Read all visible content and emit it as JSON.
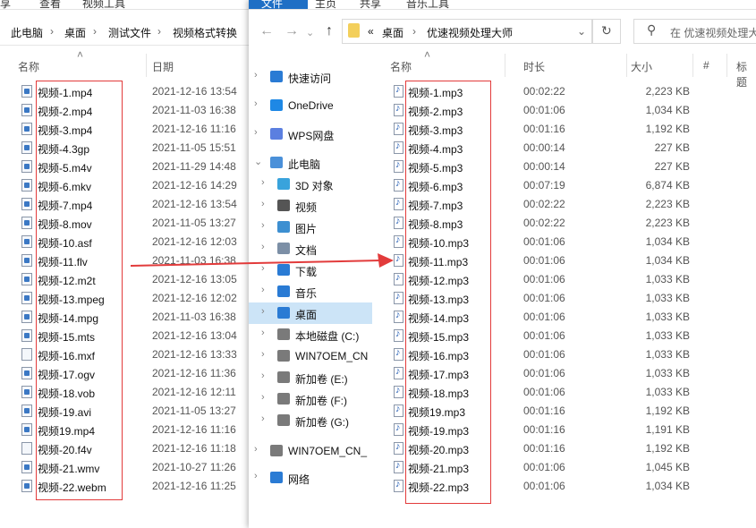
{
  "back_window": {
    "ribbon_tabs": [
      "享",
      "查看",
      "视频工具"
    ],
    "breadcrumb": [
      "此电脑",
      "桌面",
      "测试文件",
      "视频格式转换"
    ],
    "columns": {
      "name": "名称",
      "date": "日期"
    },
    "files": [
      {
        "name": "视频-1.mp4",
        "date": "2021-12-16 13:54",
        "icon": "video-file-icon"
      },
      {
        "name": "视频-2.mp4",
        "date": "2021-11-03 16:38",
        "icon": "video-file-icon"
      },
      {
        "name": "视频-3.mp4",
        "date": "2021-12-16 11:16",
        "icon": "video-file-icon"
      },
      {
        "name": "视频-4.3gp",
        "date": "2021-11-05 15:51",
        "icon": "video-file-icon"
      },
      {
        "name": "视频-5.m4v",
        "date": "2021-11-29 14:48",
        "icon": "video-file-icon"
      },
      {
        "name": "视频-6.mkv",
        "date": "2021-12-16 14:29",
        "icon": "video-file-icon"
      },
      {
        "name": "视频-7.mp4",
        "date": "2021-12-16 13:54",
        "icon": "video-file-icon"
      },
      {
        "name": "视频-8.mov",
        "date": "2021-11-05 13:27",
        "icon": "video-file-icon"
      },
      {
        "name": "视频-10.asf",
        "date": "2021-12-16 12:03",
        "icon": "video-file-icon"
      },
      {
        "name": "视频-11.flv",
        "date": "2021-11-03 16:38",
        "icon": "video-file-icon"
      },
      {
        "name": "视频-12.m2t",
        "date": "2021-12-16 13:05",
        "icon": "video-file-icon"
      },
      {
        "name": "视频-13.mpeg",
        "date": "2021-12-16 12:02",
        "icon": "video-file-icon"
      },
      {
        "name": "视频-14.mpg",
        "date": "2021-11-03 16:38",
        "icon": "video-file-icon"
      },
      {
        "name": "视频-15.mts",
        "date": "2021-12-16 13:04",
        "icon": "video-file-icon"
      },
      {
        "name": "视频-16.mxf",
        "date": "2021-12-16 13:33",
        "icon": "blank-file-icon"
      },
      {
        "name": "视频-17.ogv",
        "date": "2021-12-16 11:36",
        "icon": "video-file-icon"
      },
      {
        "name": "视频-18.vob",
        "date": "2021-12-16 12:11",
        "icon": "video-file-icon"
      },
      {
        "name": "视频-19.avi",
        "date": "2021-11-05 13:27",
        "icon": "video-file-icon"
      },
      {
        "name": "视频19.mp4",
        "date": "2021-12-16 11:16",
        "icon": "video-file-icon"
      },
      {
        "name": "视频-20.f4v",
        "date": "2021-12-16 11:18",
        "icon": "blank-file-icon"
      },
      {
        "name": "视频-21.wmv",
        "date": "2021-10-27 11:26",
        "icon": "video-file-icon"
      },
      {
        "name": "视频-22.webm",
        "date": "2021-12-16 11:25",
        "icon": "video-file-icon"
      }
    ]
  },
  "front_window": {
    "ribbon_tabs": [
      "文件",
      "主页",
      "共享",
      "音乐工具"
    ],
    "address": {
      "prefix": "«",
      "parts": [
        "桌面",
        "优速视频处理大师"
      ]
    },
    "search_placeholder": "在 优速视频处理大",
    "nav": [
      {
        "label": "快速访问",
        "icon": "star-icon",
        "color": "#2a7bd4"
      },
      {
        "label": "OneDrive",
        "icon": "cloud-icon",
        "color": "#1e88e5"
      },
      {
        "label": "WPS网盘",
        "icon": "cloud-icon",
        "color": "#5b7fe0"
      },
      {
        "label": "此电脑",
        "icon": "computer-icon",
        "color": "#4a90d9"
      },
      {
        "label": "3D 对象",
        "icon": "cube-icon",
        "color": "#39a3dc"
      },
      {
        "label": "视频",
        "icon": "film-icon",
        "color": "#555555"
      },
      {
        "label": "图片",
        "icon": "picture-icon",
        "color": "#3d8fd1"
      },
      {
        "label": "文档",
        "icon": "document-icon",
        "color": "#7c8fa6"
      },
      {
        "label": "下载",
        "icon": "download-icon",
        "color": "#2a7bd4"
      },
      {
        "label": "音乐",
        "icon": "music-icon",
        "color": "#2a7bd4"
      },
      {
        "label": "桌面",
        "icon": "desktop-icon",
        "color": "#2a7bd4"
      },
      {
        "label": "本地磁盘 (C:)",
        "icon": "drive-icon",
        "color": "#7a7a7a"
      },
      {
        "label": "WIN7OEM_CN",
        "icon": "drive-icon",
        "color": "#7a7a7a"
      },
      {
        "label": "新加卷 (E:)",
        "icon": "drive-icon",
        "color": "#7a7a7a"
      },
      {
        "label": "新加卷 (F:)",
        "icon": "drive-icon",
        "color": "#7a7a7a"
      },
      {
        "label": "新加卷 (G:)",
        "icon": "drive-icon",
        "color": "#7a7a7a"
      },
      {
        "label": "WIN7OEM_CN_",
        "icon": "drive-icon",
        "color": "#7a7a7a"
      },
      {
        "label": "网络",
        "icon": "network-icon",
        "color": "#2a7bd4"
      }
    ],
    "columns": {
      "name": "名称",
      "length": "时长",
      "size": "大小",
      "number": "#",
      "title": "标题"
    },
    "files": [
      {
        "name": "视频-1.mp3",
        "length": "00:02:22",
        "size": "2,223 KB"
      },
      {
        "name": "视频-2.mp3",
        "length": "00:01:06",
        "size": "1,034 KB"
      },
      {
        "name": "视频-3.mp3",
        "length": "00:01:16",
        "size": "1,192 KB"
      },
      {
        "name": "视频-4.mp3",
        "length": "00:00:14",
        "size": "227 KB"
      },
      {
        "name": "视频-5.mp3",
        "length": "00:00:14",
        "size": "227 KB"
      },
      {
        "name": "视频-6.mp3",
        "length": "00:07:19",
        "size": "6,874 KB"
      },
      {
        "name": "视频-7.mp3",
        "length": "00:02:22",
        "size": "2,223 KB"
      },
      {
        "name": "视频-8.mp3",
        "length": "00:02:22",
        "size": "2,223 KB"
      },
      {
        "name": "视频-10.mp3",
        "length": "00:01:06",
        "size": "1,034 KB"
      },
      {
        "name": "视频-11.mp3",
        "length": "00:01:06",
        "size": "1,034 KB"
      },
      {
        "name": "视频-12.mp3",
        "length": "00:01:06",
        "size": "1,033 KB"
      },
      {
        "name": "视频-13.mp3",
        "length": "00:01:06",
        "size": "1,033 KB"
      },
      {
        "name": "视频-14.mp3",
        "length": "00:01:06",
        "size": "1,033 KB"
      },
      {
        "name": "视频-15.mp3",
        "length": "00:01:06",
        "size": "1,033 KB"
      },
      {
        "name": "视频-16.mp3",
        "length": "00:01:06",
        "size": "1,033 KB"
      },
      {
        "name": "视频-17.mp3",
        "length": "00:01:06",
        "size": "1,033 KB"
      },
      {
        "name": "视频-18.mp3",
        "length": "00:01:06",
        "size": "1,033 KB"
      },
      {
        "name": "视频19.mp3",
        "length": "00:01:16",
        "size": "1,192 KB"
      },
      {
        "name": "视频-19.mp3",
        "length": "00:01:16",
        "size": "1,191 KB"
      },
      {
        "name": "视频-20.mp3",
        "length": "00:01:16",
        "size": "1,192 KB"
      },
      {
        "name": "视频-21.mp3",
        "length": "00:01:06",
        "size": "1,045 KB"
      },
      {
        "name": "视频-22.mp3",
        "length": "00:01:06",
        "size": "1,034 KB"
      }
    ]
  },
  "colors": {
    "highlight_box": "#e23b3b",
    "arrow": "#e23b3b",
    "selection": "#cce4f7",
    "file_tab": "#1f6fc5"
  }
}
